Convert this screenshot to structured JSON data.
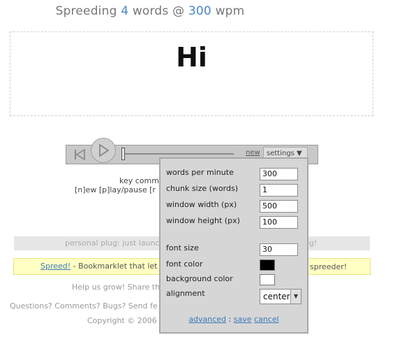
{
  "header": {
    "prefix": "Spreeding",
    "word_count": "4",
    "middle": "words @",
    "wpm": "300",
    "suffix": "wpm"
  },
  "display": {
    "current_word": "Hi"
  },
  "player": {
    "new_label": "new",
    "settings_label": "settings ▼",
    "progress_fraction": 0.0
  },
  "key_commands": {
    "line1": "key comm",
    "line2": "[n]ew [p]lay/pause [r"
  },
  "plug": {
    "text": "personal plug: just launc",
    "end": "og!"
  },
  "bookmarklet": {
    "link": "Spreed!",
    "text": " - Bookmarklet that let",
    "end": "spreeder!"
  },
  "footer": {
    "help": "Help us grow! Share th",
    "questions": "Questions? Comments? Bugs? Send fe",
    "copyright": "Copyright © 2006"
  },
  "settings": {
    "wpm_label": "words per minute",
    "wpm_value": "300",
    "chunk_label": "chunk size (words)",
    "chunk_value": "1",
    "width_label": "window width (px)",
    "width_value": "500",
    "height_label": "window height (px)",
    "height_value": "100",
    "font_size_label": "font size",
    "font_size_value": "30",
    "font_color_label": "font color",
    "font_color": "#000000",
    "bg_color_label": "background color",
    "bg_color": "#ffffff",
    "alignment_label": "alignment",
    "alignment_value": "center",
    "advanced_label": "advanced",
    "separator": ":",
    "save_label": "save",
    "cancel_label": "cancel"
  }
}
